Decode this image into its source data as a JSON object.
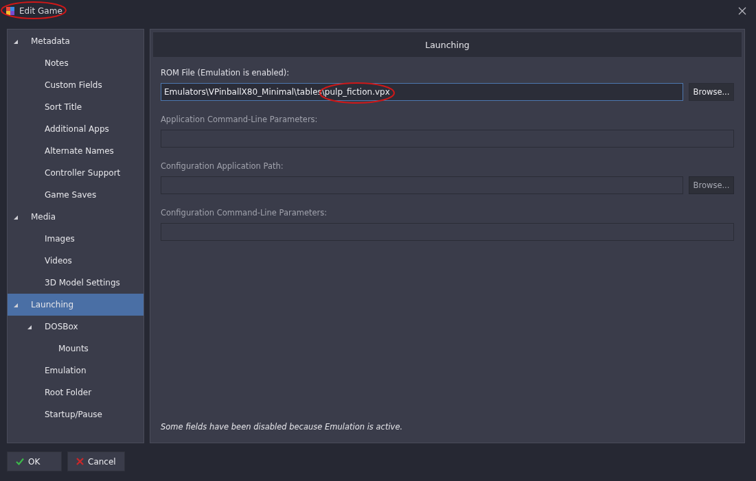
{
  "window": {
    "title": "Edit Game"
  },
  "sidebar": {
    "items": [
      {
        "label": "Metadata",
        "selected": false,
        "expanded": true,
        "children": [
          {
            "label": "Notes",
            "selected": false
          },
          {
            "label": "Custom Fields",
            "selected": false
          },
          {
            "label": "Sort Title",
            "selected": false
          },
          {
            "label": "Additional Apps",
            "selected": false
          },
          {
            "label": "Alternate Names",
            "selected": false
          },
          {
            "label": "Controller Support",
            "selected": false
          },
          {
            "label": "Game Saves",
            "selected": false
          }
        ]
      },
      {
        "label": "Media",
        "selected": false,
        "expanded": true,
        "children": [
          {
            "label": "Images",
            "selected": false
          },
          {
            "label": "Videos",
            "selected": false
          },
          {
            "label": "3D Model Settings",
            "selected": false
          }
        ]
      },
      {
        "label": "Launching",
        "selected": true,
        "expanded": true,
        "children": [
          {
            "label": "DOSBox",
            "selected": false,
            "expanded": true,
            "children": [
              {
                "label": "Mounts",
                "selected": false
              }
            ]
          },
          {
            "label": "Emulation",
            "selected": false
          },
          {
            "label": "Root Folder",
            "selected": false
          },
          {
            "label": "Startup/Pause",
            "selected": false
          }
        ]
      }
    ]
  },
  "panel": {
    "header": "Launching",
    "fields": [
      {
        "label": "ROM File (Emulation is enabled):",
        "value": "Emulators\\VPinballX80_Minimal\\tables\\pulp_fiction.vpx",
        "disabled": false,
        "browse": "Browse..."
      },
      {
        "label": "Application Command-Line Parameters:",
        "disabled": true
      },
      {
        "label": "Configuration Application Path:",
        "disabled": true,
        "browse": "Browse..."
      },
      {
        "label": "Configuration Command-Line Parameters:",
        "disabled": true
      }
    ],
    "note": "Some fields have been disabled because Emulation is active."
  },
  "buttons": [
    {
      "label": "OK",
      "kind": "ok"
    },
    {
      "label": "Cancel",
      "kind": "cancel"
    }
  ]
}
